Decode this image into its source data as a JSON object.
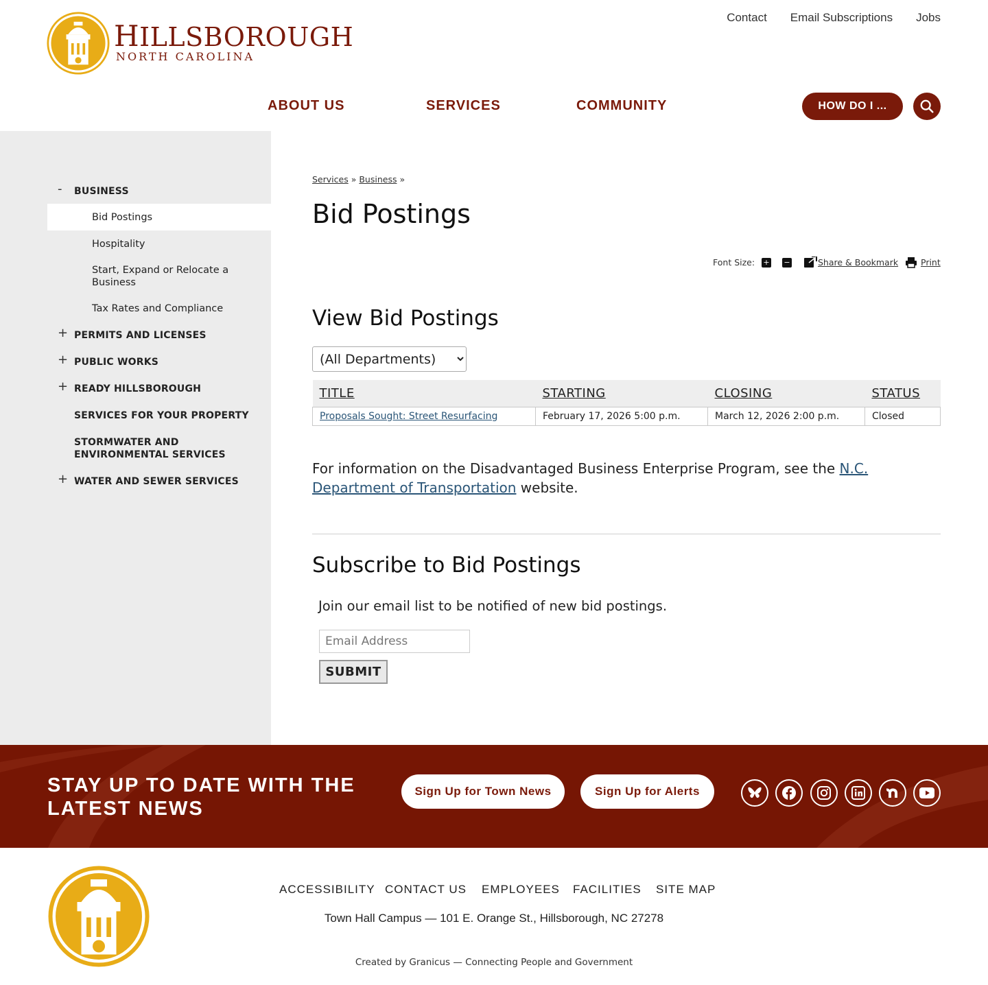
{
  "brand": {
    "title_first": "H",
    "title_rest": "ILLSBOROUGH",
    "subtitle": "NORTH CAROLINA",
    "primary_color": "#7a1a0a",
    "seal_color": "#e8ac17"
  },
  "utility_nav": [
    "Contact",
    "Email Subscriptions",
    "Jobs"
  ],
  "main_nav": {
    "about": "ABOUT US",
    "services": "SERVICES",
    "community": "COMMUNITY",
    "how_do_i": "HOW DO I ..."
  },
  "sidebar": {
    "business": {
      "toggle": "-",
      "label": "BUSINESS"
    },
    "sub_items": [
      "Bid Postings",
      "Hospitality",
      "Start, Expand or Relocate a Business",
      "Tax Rates and Compliance"
    ],
    "top_items": [
      {
        "toggle": "+",
        "label": "PERMITS AND LICENSES"
      },
      {
        "toggle": "+",
        "label": "PUBLIC WORKS"
      },
      {
        "toggle": "+",
        "label": "READY HILLSBOROUGH"
      },
      {
        "toggle": "",
        "label": "SERVICES FOR YOUR PROPERTY"
      },
      {
        "toggle": "",
        "label": "STORMWATER AND ENVIRONMENTAL SERVICES"
      },
      {
        "toggle": "+",
        "label": "WATER AND SEWER SERVICES"
      }
    ]
  },
  "breadcrumb": {
    "items": [
      "Services",
      "Business"
    ],
    "separator": "»"
  },
  "page_title": "Bid Postings",
  "tools": {
    "font_size_label": "Font Size:",
    "increase": "+",
    "decrease": "−",
    "share": "Share & Bookmark",
    "print": "Print"
  },
  "bids": {
    "heading": "View Bid Postings",
    "department_options": [
      "(All Departments)"
    ],
    "columns": [
      "TITLE",
      "STARTING",
      "CLOSING",
      "STATUS"
    ],
    "rows": [
      {
        "title": "Proposals Sought: Street Resurfacing",
        "starting": "February 17, 2026 5:00 p.m.",
        "closing": "March 12, 2026 2:00 p.m.",
        "status": "Closed"
      }
    ]
  },
  "info": {
    "before": "For information on the Disadvantaged Business Enterprise Program, see the ",
    "link": "N.C. Department of Transportation",
    "after": " website."
  },
  "subscribe": {
    "heading": "Subscribe to Bid Postings",
    "text": "Join our email list to be notified of new bid postings.",
    "email_placeholder": "Email Address",
    "submit": "SUBMIT"
  },
  "news_band": {
    "title": "STAY UP TO DATE WITH THE LATEST NEWS",
    "town_news": "Sign Up for Town News",
    "alerts": "Sign Up for Alerts",
    "background_color": "#761604",
    "social_icons": [
      "bluesky-icon",
      "facebook-icon",
      "instagram-icon",
      "linkedin-icon",
      "nextdoor-icon",
      "youtube-icon"
    ]
  },
  "footer": {
    "links": [
      "ACCESSIBILITY",
      "CONTACT US",
      "EMPLOYEES",
      "FACILITIES",
      "SITE MAP"
    ],
    "address": "Town Hall Campus — 101 E. Orange St., Hillsborough, NC 27278",
    "credit": "Created by Granicus — Connecting People and Government"
  }
}
